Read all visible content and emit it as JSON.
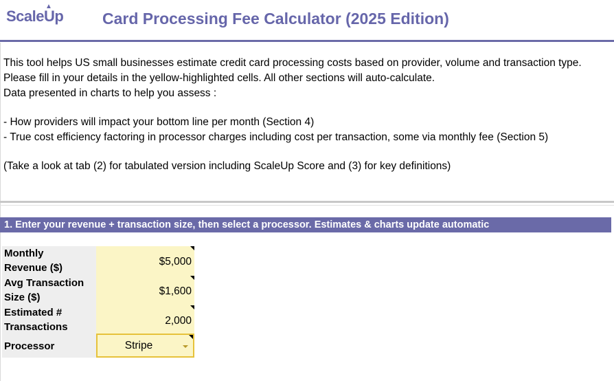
{
  "header": {
    "logo_text_a": "Scale",
    "logo_text_b": "Up",
    "title": "Card Processing Fee Calculator (2025 Edition)"
  },
  "intro": {
    "line1": "This tool helps US small businesses estimate credit card processing costs based on provider, volume and transaction type.",
    "line2": "Please fill in your details in the yellow-highlighted cells. All other sections will auto-calculate.",
    "line3": "Data presented in charts to help you assess :",
    "bullet1": " - How providers will impact your bottom line per month (Section 4)",
    "bullet2": " - True cost efficiency factoring in processor charges including cost per transaction, some via monthly fee (Section 5)",
    "note": " (Take a look at tab (2) for tabulated version including ScaleUp Score and (3) for key definitions)"
  },
  "section1": {
    "banner": "1. Enter your revenue + transaction size, then select a processor. Estimates & charts update automatic"
  },
  "inputs": {
    "monthly_revenue_label_1": "Monthly",
    "monthly_revenue_label_2": "Revenue ($)",
    "monthly_revenue_value": "$5,000",
    "avg_txn_label_1": "Avg Transaction",
    "avg_txn_label_2": "Size ($)",
    "avg_txn_value": "$1,600",
    "est_txn_label_1": "Estimated #",
    "est_txn_label_2": "Transactions",
    "est_txn_value": "2,000",
    "processor_label": "Processor",
    "processor_value": "Stripe"
  },
  "colors": {
    "accent": "#6a6aa8",
    "input_fill": "#fbf5c6",
    "label_fill": "#eeeeee",
    "select_border": "#e6c23a"
  }
}
